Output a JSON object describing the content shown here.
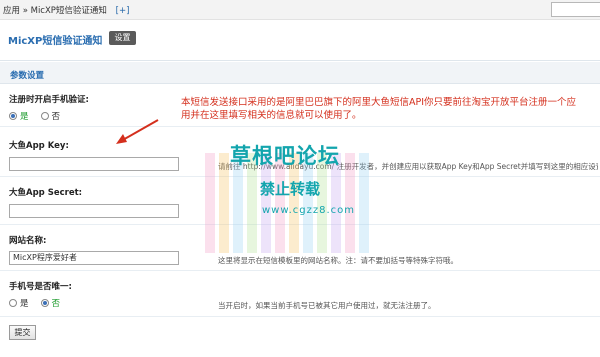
{
  "topbar": {
    "breadcrumb": "应用 » MicXP短信验证通知",
    "add_label": "[+]"
  },
  "header": {
    "title": "MicXP短信验证通知",
    "settings_button": "设置"
  },
  "panel": {
    "heading": "参数设置"
  },
  "fields": {
    "enable_sms": {
      "label": "注册时开启手机验证:",
      "opt_yes": "是",
      "opt_no": "否",
      "selected": "是"
    },
    "app_key": {
      "label": "大鱼App Key:",
      "value": "",
      "hint": "请前往 http://www.alidayu.com/ 注册开发者，并创建应用以获取App Key和App Secret并填写到这里的相应设置项。"
    },
    "app_secret": {
      "label": "大鱼App Secret:",
      "value": ""
    },
    "site_name": {
      "label": "网站名称:",
      "value": "MicXP程序爱好者",
      "hint": "这里将显示在短信模板里的网站名称。注：请不要加括号等特殊字符哦。"
    },
    "unique_phone": {
      "label": "手机号是否唯一:",
      "opt_yes": "是",
      "opt_no": "否",
      "selected": "否",
      "hint": "当开启时，如果当前手机号已被其它用户使用过，就无法注册了。"
    }
  },
  "submit_label": "提交",
  "annotation": "本短信发送接口采用的是阿里巴巴旗下的阿里大鱼短信API你只要前往淘宝开放平台注册一个应用并在这里填写相关的信息就可以使用了。",
  "watermark": {
    "title": "草根吧论坛",
    "subtitle": "禁止转载",
    "url": "www.cgzz8.com"
  },
  "colors": {
    "accent": "#2a6db0",
    "note_red": "#d42f1d",
    "watermark": "#13a5ad"
  }
}
